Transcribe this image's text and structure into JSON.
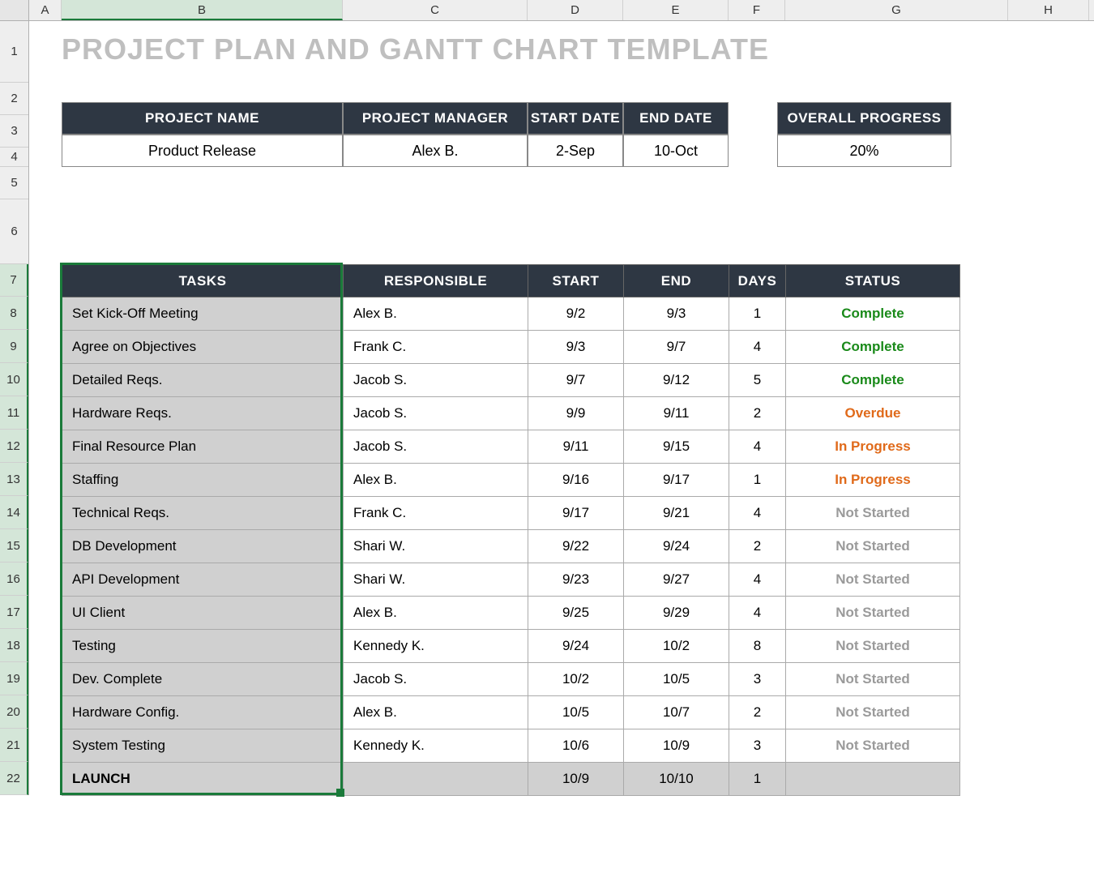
{
  "columns": [
    "A",
    "B",
    "C",
    "D",
    "E",
    "F",
    "G",
    "H"
  ],
  "rows": {
    "heights": [
      76,
      40,
      40,
      24,
      40,
      80,
      40,
      41,
      41,
      41,
      41,
      41,
      41,
      41,
      41,
      41,
      41,
      41,
      41,
      41,
      41,
      41
    ]
  },
  "title": "PROJECT PLAN AND GANTT CHART TEMPLATE",
  "info": {
    "headers": {
      "name": "PROJECT NAME",
      "manager": "PROJECT MANAGER",
      "start": "START DATE",
      "end": "END DATE",
      "progress": "OVERALL PROGRESS"
    },
    "values": {
      "name": "Product Release",
      "manager": "Alex B.",
      "start": "2-Sep",
      "end": "10-Oct",
      "progress": "20%"
    }
  },
  "task_headers": {
    "tasks": "TASKS",
    "responsible": "RESPONSIBLE",
    "start": "START",
    "end": "END",
    "days": "DAYS",
    "status": "STATUS"
  },
  "tasks": [
    {
      "name": "Set Kick-Off Meeting",
      "responsible": "Alex B.",
      "start": "9/2",
      "end": "9/3",
      "days": "1",
      "status": "Complete",
      "status_class": "s-complete"
    },
    {
      "name": "Agree on Objectives",
      "responsible": "Frank C.",
      "start": "9/3",
      "end": "9/7",
      "days": "4",
      "status": "Complete",
      "status_class": "s-complete"
    },
    {
      "name": "Detailed Reqs.",
      "responsible": "Jacob S.",
      "start": "9/7",
      "end": "9/12",
      "days": "5",
      "status": "Complete",
      "status_class": "s-complete"
    },
    {
      "name": "Hardware Reqs.",
      "responsible": "Jacob S.",
      "start": "9/9",
      "end": "9/11",
      "days": "2",
      "status": "Overdue",
      "status_class": "s-overdue"
    },
    {
      "name": "Final Resource Plan",
      "responsible": "Jacob S.",
      "start": "9/11",
      "end": "9/15",
      "days": "4",
      "status": "In Progress",
      "status_class": "s-inprogress"
    },
    {
      "name": "Staffing",
      "responsible": "Alex B.",
      "start": "9/16",
      "end": "9/17",
      "days": "1",
      "status": "In Progress",
      "status_class": "s-inprogress"
    },
    {
      "name": "Technical Reqs.",
      "responsible": "Frank C.",
      "start": "9/17",
      "end": "9/21",
      "days": "4",
      "status": "Not Started",
      "status_class": "s-notstarted"
    },
    {
      "name": "DB Development",
      "responsible": "Shari W.",
      "start": "9/22",
      "end": "9/24",
      "days": "2",
      "status": "Not Started",
      "status_class": "s-notstarted"
    },
    {
      "name": "API Development",
      "responsible": "Shari W.",
      "start": "9/23",
      "end": "9/27",
      "days": "4",
      "status": "Not Started",
      "status_class": "s-notstarted"
    },
    {
      "name": "UI Client",
      "responsible": "Alex B.",
      "start": "9/25",
      "end": "9/29",
      "days": "4",
      "status": "Not Started",
      "status_class": "s-notstarted"
    },
    {
      "name": "Testing",
      "responsible": "Kennedy K.",
      "start": "9/24",
      "end": "10/2",
      "days": "8",
      "status": "Not Started",
      "status_class": "s-notstarted"
    },
    {
      "name": "Dev. Complete",
      "responsible": "Jacob S.",
      "start": "10/2",
      "end": "10/5",
      "days": "3",
      "status": "Not Started",
      "status_class": "s-notstarted"
    },
    {
      "name": "Hardware Config.",
      "responsible": "Alex B.",
      "start": "10/5",
      "end": "10/7",
      "days": "2",
      "status": "Not Started",
      "status_class": "s-notstarted"
    },
    {
      "name": "System Testing",
      "responsible": "Kennedy K.",
      "start": "10/6",
      "end": "10/9",
      "days": "3",
      "status": "Not Started",
      "status_class": "s-notstarted"
    },
    {
      "name": "LAUNCH",
      "responsible": "",
      "start": "10/9",
      "end": "10/10",
      "days": "1",
      "status": "",
      "status_class": "",
      "launch": true
    }
  ],
  "selection": {
    "column": "B",
    "row_start": 7,
    "row_end": 22
  }
}
